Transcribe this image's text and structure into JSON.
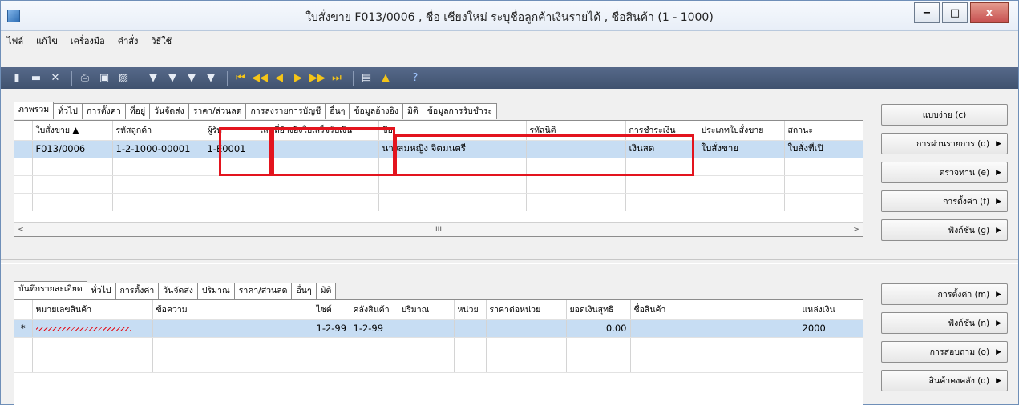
{
  "window": {
    "title": "ใบสั่งขาย F013/0006 , ชื่อ เชียงใหม่ ระบุชื่อลูกค้าเงินรายได้ , ชื่อสินค้า (1 - 1000)",
    "minimize": "−",
    "maximize": "□",
    "close": "x"
  },
  "menu": [
    "ไฟล์",
    "แก้ไข",
    "เครื่องมือ",
    "คำสั่ง",
    "วิธีใช้"
  ],
  "toolbar": {
    "icons": [
      "new-icon",
      "save-icon",
      "delete-icon",
      "print-icon",
      "print-preview-icon",
      "export-icon",
      "filter-icon",
      "filter-by-selection-icon",
      "advanced-filter-icon",
      "remove-filter-icon",
      "first-record-icon",
      "previous-page-icon",
      "previous-record-icon",
      "next-record-icon",
      "next-page-icon",
      "last-record-icon",
      "attachment-icon",
      "alert-icon",
      "help-icon"
    ],
    "glyphs": [
      "▮",
      "▬",
      "✕",
      "⎙",
      "▣",
      "▨",
      "▼",
      "▼",
      "▼",
      "▼",
      "⏮",
      "◀◀",
      "◀",
      "▶",
      "▶▶",
      "⏭",
      "▤",
      "▲",
      "?"
    ]
  },
  "header": {
    "tabs": [
      "ภาพรวม",
      "ทั่วไป",
      "การตั้งค่า",
      "ที่อยู่",
      "วันจัดส่ง",
      "ราคา/ส่วนลด",
      "การลงรายการบัญชี",
      "อื่นๆ",
      "ข้อมูลอ้างอิง",
      "มิติ",
      "ข้อมูลการรับชำระ"
    ],
    "columns": [
      "ใบสั่งขาย ▲",
      "รหัสลูกค้า",
      "ผู้รับ",
      "เลขที่อ้างอิงใบเสร็จรับเงิน",
      "ชื่อ",
      "รหัสนิติ",
      "การชำระเงิน",
      "ประเภทใบสั่งขาย",
      "สถานะ"
    ],
    "row": [
      "F013/0006",
      "1-2-1000-00001",
      "1-E0001",
      "",
      "นางสมหญิง จิตมนตรี",
      "",
      "เงินสด",
      "ใบสั่งขาย",
      "ใบสั่งที่เปิ"
    ],
    "scroll_left": "<",
    "scroll_mid": "III",
    "scroll_right": ">"
  },
  "header_buttons": [
    "แบบง่าย (c)",
    "การผ่านรายการ (d)",
    "ตรวจทาน (e)",
    "การตั้งค่า (f)",
    "ฟังก์ชัน (g)"
  ],
  "lines": {
    "tabs": [
      "บันทึกรายละเอียด",
      "ทั่วไป",
      "การตั้งค่า",
      "วันจัดส่ง",
      "ปริมาณ",
      "ราคา/ส่วนลด",
      "อื่นๆ",
      "มิติ"
    ],
    "columns": [
      "หมายเลขสินค้า",
      "ข้อความ",
      "ไซต์",
      "คลังสินค้า",
      "ปริมาณ",
      "หน่วย",
      "ราคาต่อหน่วย",
      "ยอดเงินสุทธิ",
      "ชื่อสินค้า",
      "แหล่งเงิน"
    ],
    "row_marker": "*",
    "row": [
      "",
      "",
      "1-2-99",
      "1-2-99",
      "",
      "",
      "",
      "0.00",
      "",
      "2000"
    ]
  },
  "line_buttons": [
    "การตั้งค่า (m)",
    "ฟังก์ชัน (n)",
    "การสอบถาม (o)",
    "สินค้าคงคลัง (q)"
  ],
  "colors": {
    "highlight": "#e3141e",
    "selected_row": "#c7ddf3",
    "toolbar": "#4a5c7a"
  }
}
